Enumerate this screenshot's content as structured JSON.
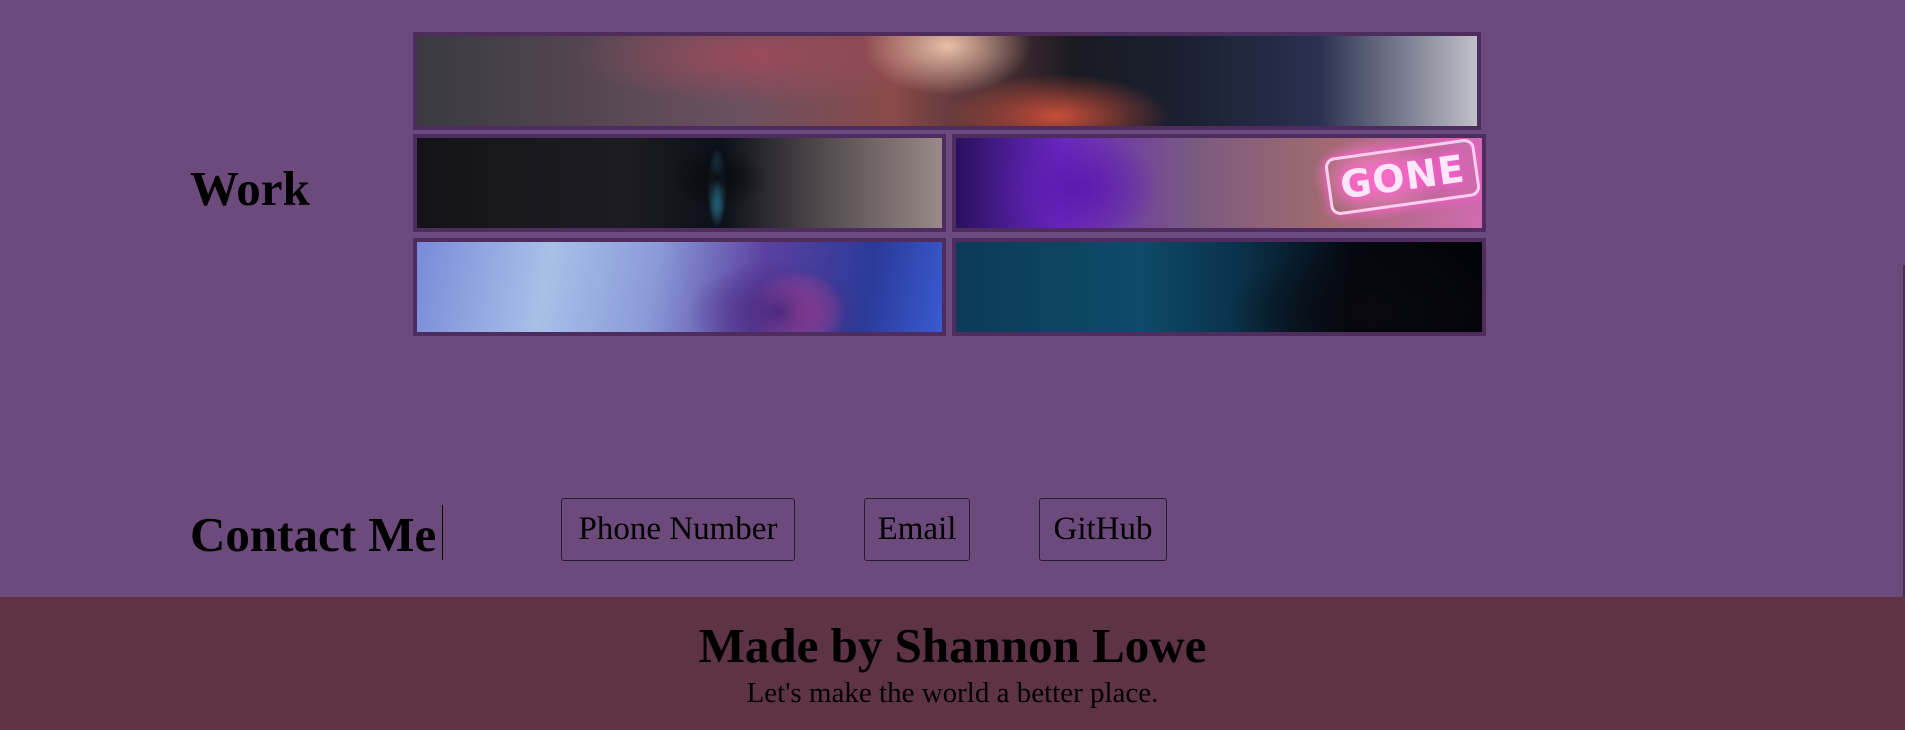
{
  "work": {
    "heading": "Work",
    "tiles": [
      {
        "label": "work-tile-1"
      },
      {
        "label": "work-tile-2"
      },
      {
        "label": "work-tile-3",
        "neon_text": "GONE"
      },
      {
        "label": "work-tile-4"
      },
      {
        "label": "work-tile-5"
      }
    ]
  },
  "contact": {
    "heading": "Contact Me",
    "buttons": {
      "phone": "Phone Number",
      "email": "Email",
      "github": "GitHub"
    }
  },
  "footer": {
    "title": "Made by Shannon Lowe",
    "tagline": "Let's make the world a better place."
  },
  "colors": {
    "background": "#6d4a7c",
    "footer_background": "#5e3345",
    "tile_border": "#4f2c5e"
  }
}
